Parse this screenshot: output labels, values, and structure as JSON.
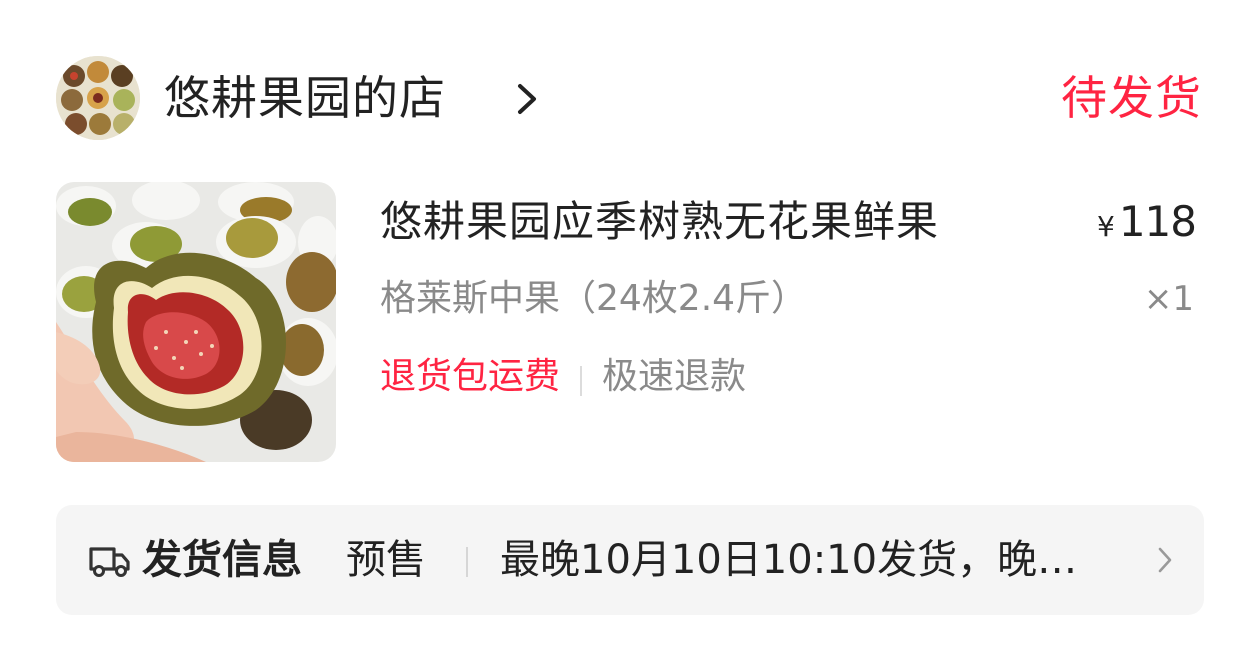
{
  "shop": {
    "name": "悠耕果园的店",
    "status": "待发货",
    "avatar_icon": "shop-avatar-fruit-grid",
    "chevron_icon": "chevron-right-icon"
  },
  "product": {
    "title": "悠耕果园应季树熟无花果鲜果",
    "price_currency": "¥",
    "price": "118",
    "spec": "格莱斯中果（24枚2.4斤）",
    "quantity": "×1",
    "tags": [
      "退货包运费",
      "极速退款"
    ],
    "image_icon": "fig-product-image"
  },
  "shipping": {
    "title": "发货信息",
    "type": "预售",
    "text": "最晚10月10日10:10发货，晚…",
    "icon": "truck-icon",
    "chevron_icon": "chevron-right-icon"
  },
  "colors": {
    "accent": "#ff2442",
    "text_primary": "#222222",
    "text_secondary": "#8a8a8a",
    "panel_bg": "#f5f5f5"
  }
}
